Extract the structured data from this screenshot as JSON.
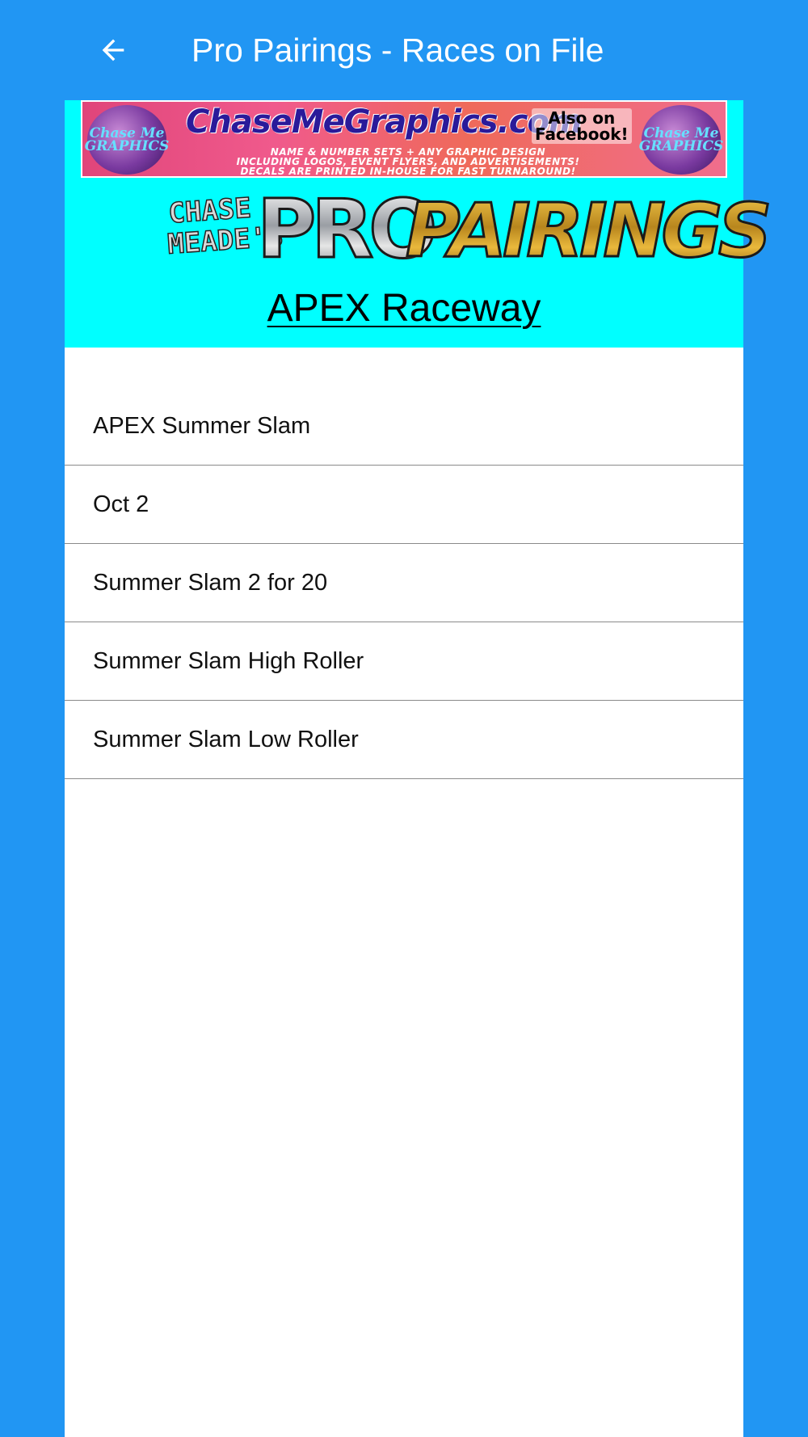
{
  "app_bar": {
    "title": "Pro Pairings - Races on File",
    "back_icon": "arrow-left-icon"
  },
  "ad_banner": {
    "headline": "ChaseMeGraphics.com",
    "facebook_note": "Also on\nFacebook!",
    "badge_text": "Chase Me\nGRAPHICS",
    "line1": "NAME & NUMBER SETS + ANY GRAPHIC DESIGN",
    "line2": "INCLUDING LOGOS, EVENT FLYERS, AND ADVERTISEMENTS!",
    "line3": "DECALS ARE PRINTED IN-HOUSE FOR FAST TURNAROUND!"
  },
  "logo": {
    "prefix": "CHASE\nMEADE'S",
    "word1": "PRO",
    "word2": "PAIRINGS"
  },
  "track": {
    "name": "APEX Raceway"
  },
  "races": [
    {
      "label": "APEX Summer Slam"
    },
    {
      "label": "Oct 2"
    },
    {
      "label": "Summer Slam 2 for 20"
    },
    {
      "label": "Summer Slam High Roller"
    },
    {
      "label": "Summer Slam Low Roller"
    }
  ],
  "colors": {
    "primary": "#2196F3",
    "header_background": "#00FFFF",
    "list_background": "#FFFFFF",
    "divider": "#8A8A8A"
  }
}
